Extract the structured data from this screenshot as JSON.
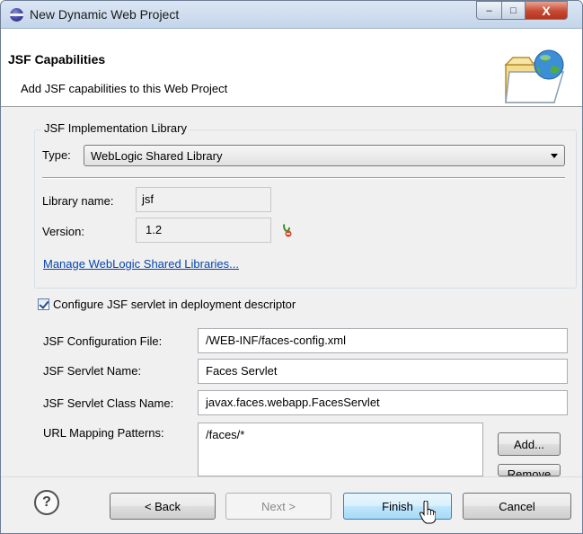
{
  "window": {
    "title": "New Dynamic Web Project",
    "minimize": "‒",
    "maximize": "□",
    "close": "X"
  },
  "header": {
    "title": "JSF Capabilities",
    "description": "Add JSF capabilities to this Web Project"
  },
  "implementation": {
    "group_label": "JSF Implementation Library",
    "type_label": "Type:",
    "type_value": "WebLogic Shared Library",
    "library_name_label": "Library name:",
    "library_name_value": "jsf",
    "version_label": "Version:",
    "version_value": "1.2",
    "manage_link": "Manage WebLogic Shared Libraries..."
  },
  "servlet": {
    "configure_label": "Configure JSF servlet in deployment descriptor",
    "configure_checked": true,
    "config_file_label": "JSF Configuration File:",
    "config_file_value": "/WEB-INF/faces-config.xml",
    "servlet_name_label": "JSF Servlet Name:",
    "servlet_name_value": "Faces Servlet",
    "servlet_class_label": "JSF Servlet Class Name:",
    "servlet_class_value": "javax.faces.webapp.FacesServlet",
    "url_patterns_label": "URL Mapping Patterns:",
    "url_patterns": [
      "/faces/*"
    ],
    "add_button": "Add...",
    "remove_button": "Remove"
  },
  "footer": {
    "help": "?",
    "back": "< Back",
    "next": "Next >",
    "finish": "Finish",
    "cancel": "Cancel"
  }
}
